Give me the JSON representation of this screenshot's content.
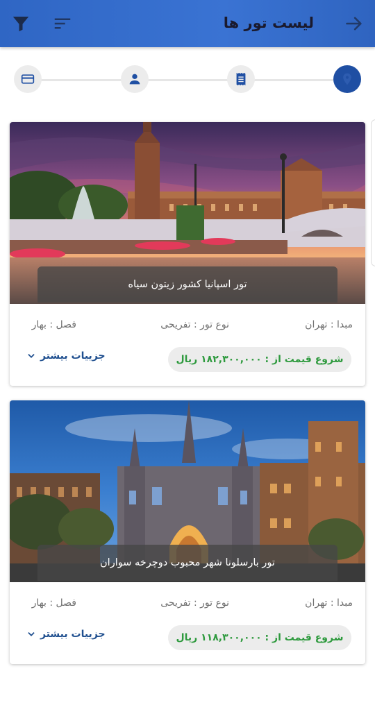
{
  "header": {
    "title": "لیست تور ها",
    "back_icon": "arrow-right-icon",
    "sort_icon": "sort-icon",
    "filter_icon": "filter-icon",
    "color": "#2f66c4"
  },
  "stepper": {
    "steps": [
      {
        "icon": "location-icon",
        "active": true
      },
      {
        "icon": "receipt-icon",
        "active": false
      },
      {
        "icon": "person-icon",
        "active": false
      },
      {
        "icon": "credit-card-icon",
        "active": false
      }
    ],
    "active_color": "#1f4fa3"
  },
  "tours": [
    {
      "title": "تور اسپانیا کشور زیتون سیاه",
      "origin": "مبدا : تهران",
      "type": "نوع تور : تفریحی",
      "season": "فصل : بهار",
      "price": "شروع قیمت از : ۱۸۲,۳۰۰,۰۰۰ ریال",
      "more": "جزییات بیشتر"
    },
    {
      "title": "تور بارسلونا شهر محبوب دوچرخه سواران",
      "origin": "مبدا : تهران",
      "type": "نوع تور : تفریحی",
      "season": "فصل : بهار",
      "price": "شروع قیمت از : ۱۱۸,۳۰۰,۰۰۰ ریال",
      "more": "جزییات بیشتر"
    }
  ],
  "price_color": "#2e9a3e"
}
